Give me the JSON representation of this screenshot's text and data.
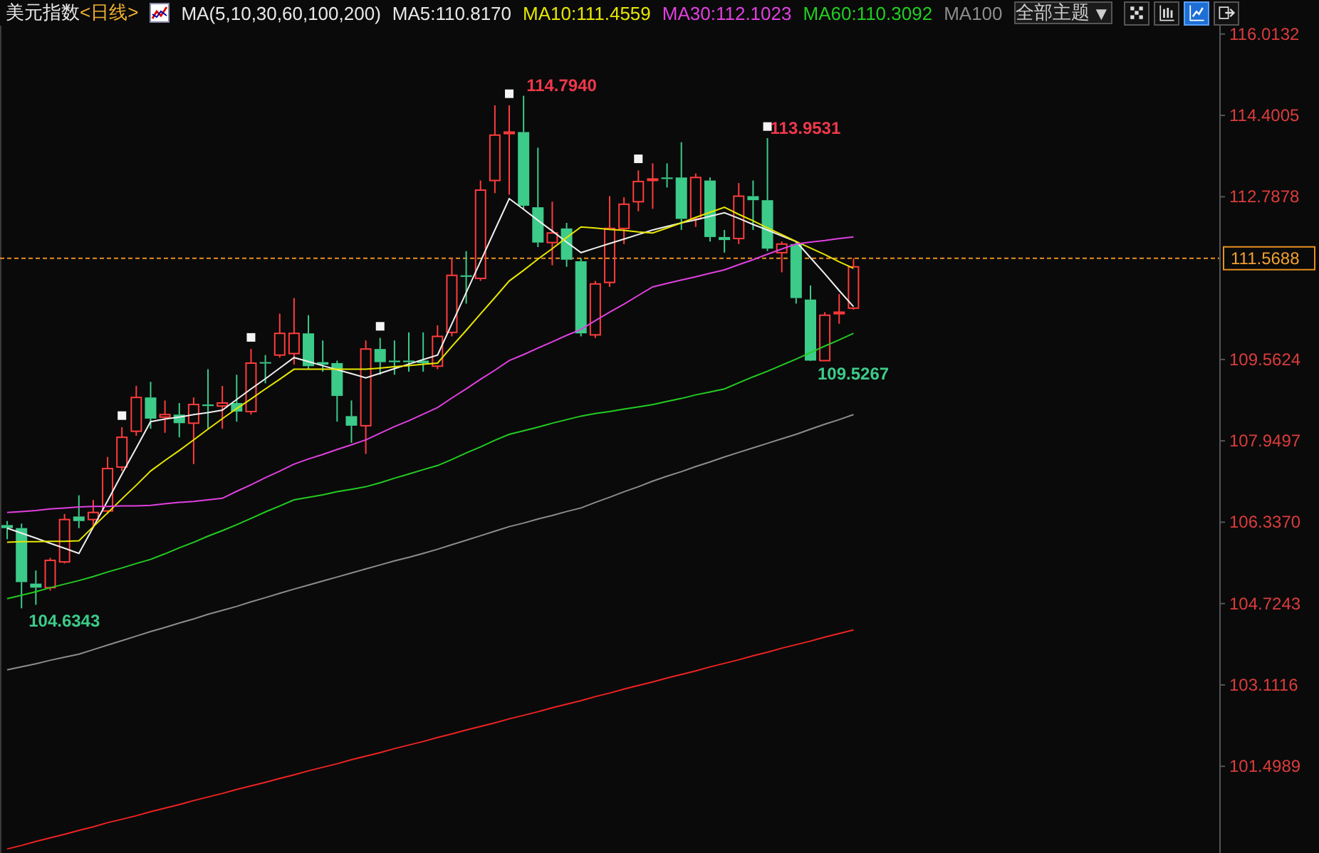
{
  "header": {
    "symbol": "美元指数",
    "period": "<日线>",
    "indicator": "MA(5,10,30,60,100,200)",
    "ma_values": [
      {
        "label": "MA5:110.8170",
        "color": "#e8e8e8"
      },
      {
        "label": "MA10:111.4559",
        "color": "#e6e600"
      },
      {
        "label": "MA30:112.1023",
        "color": "#e040e0"
      },
      {
        "label": "MA60:110.3092",
        "color": "#22cc22"
      },
      {
        "label": "MA100",
        "color": "#8c8c8c"
      }
    ],
    "theme_select": {
      "value": "全部主题",
      "caret": "▼"
    },
    "tools": [
      {
        "kind": "grid",
        "selected": false
      },
      {
        "kind": "bars",
        "selected": false
      },
      {
        "kind": "chart",
        "selected": true
      },
      {
        "kind": "exit",
        "selected": false
      }
    ]
  },
  "chart": {
    "chart_data": {
      "type": "candlestick",
      "ylim": [
        99.78,
        116.18
      ],
      "categories": [
        null,
        null,
        null,
        null,
        null,
        null,
        null,
        null,
        null,
        null,
        null,
        null,
        null,
        null,
        null,
        null,
        null,
        null,
        null,
        null,
        null,
        null,
        null,
        null,
        null,
        null,
        null,
        null,
        null,
        null,
        null,
        null,
        null,
        null,
        null,
        null,
        null,
        null,
        null,
        null,
        null,
        null,
        null,
        null,
        null,
        null,
        null,
        null,
        null,
        null,
        null,
        null,
        null,
        null,
        null,
        null,
        null,
        null,
        null,
        null,
        null,
        null,
        null,
        null,
        null,
        null,
        null,
        null,
        null,
        null,
        null,
        null,
        null,
        null,
        null,
        null,
        null,
        null,
        null,
        null,
        null,
        null,
        null,
        null,
        null
      ],
      "yticks": [
        {
          "value": 116.0132,
          "label": "116.0132"
        },
        {
          "value": 114.4005,
          "label": "114.4005"
        },
        {
          "value": 112.7878,
          "label": "112.7878"
        },
        {
          "value": 109.5624,
          "label": "109.5624"
        },
        {
          "value": 107.9497,
          "label": "107.9497"
        },
        {
          "value": 106.337,
          "label": "106.3370"
        },
        {
          "value": 104.7243,
          "label": "104.7243"
        },
        {
          "value": 103.1116,
          "label": "103.1116"
        },
        {
          "value": 101.4989,
          "label": "101.4989"
        }
      ],
      "ohlc": [
        [
          106.28,
          106.36,
          106.0,
          106.22
        ],
        [
          106.22,
          106.31,
          104.63,
          105.15
        ],
        [
          105.12,
          105.38,
          104.7,
          105.04
        ],
        [
          105.04,
          105.63,
          104.98,
          105.58
        ],
        [
          105.55,
          106.5,
          105.52,
          106.39
        ],
        [
          106.45,
          106.87,
          106.22,
          106.36
        ],
        [
          106.39,
          106.78,
          106.22,
          106.53
        ],
        [
          106.56,
          107.63,
          106.5,
          107.4
        ],
        [
          107.43,
          108.22,
          107.35,
          108.02
        ],
        [
          108.14,
          109.04,
          108.05,
          108.81
        ],
        [
          108.81,
          109.12,
          108.19,
          108.39
        ],
        [
          108.42,
          108.75,
          108.11,
          108.47
        ],
        [
          108.47,
          108.7,
          108.02,
          108.3
        ],
        [
          108.3,
          108.81,
          107.49,
          108.67
        ],
        [
          108.67,
          109.37,
          108.19,
          108.64
        ],
        [
          108.64,
          109.04,
          108.19,
          108.7
        ],
        [
          108.7,
          109.26,
          108.33,
          108.53
        ],
        [
          108.53,
          109.77,
          108.47,
          109.49
        ],
        [
          109.51,
          109.65,
          109.09,
          109.49
        ],
        [
          109.65,
          110.47,
          109.6,
          110.08
        ],
        [
          109.68,
          110.78,
          109.46,
          110.08
        ],
        [
          110.08,
          110.44,
          109.37,
          109.43
        ],
        [
          109.51,
          109.94,
          109.32,
          109.46
        ],
        [
          109.49,
          109.54,
          108.33,
          108.84
        ],
        [
          108.44,
          108.75,
          107.91,
          108.25
        ],
        [
          108.25,
          109.94,
          107.69,
          109.77
        ],
        [
          109.77,
          109.99,
          109.26,
          109.51
        ],
        [
          109.54,
          109.94,
          109.26,
          109.51
        ],
        [
          109.54,
          110.1,
          109.32,
          109.51
        ],
        [
          109.54,
          110.1,
          109.32,
          109.49
        ],
        [
          109.43,
          110.24,
          109.37,
          110.02
        ],
        [
          110.1,
          111.57,
          110.02,
          111.23
        ],
        [
          111.23,
          111.71,
          110.67,
          111.2
        ],
        [
          111.17,
          113.11,
          111.12,
          112.92
        ],
        [
          113.11,
          114.6,
          112.86,
          114.01
        ],
        [
          114.04,
          114.6,
          112.83,
          114.07
        ],
        [
          114.07,
          114.79,
          112.55,
          112.61
        ],
        [
          112.58,
          113.76,
          111.79,
          111.88
        ],
        [
          111.88,
          112.69,
          111.43,
          112.07
        ],
        [
          112.16,
          112.27,
          111.4,
          111.54
        ],
        [
          111.51,
          111.57,
          110.02,
          110.08
        ],
        [
          110.05,
          111.12,
          109.99,
          111.06
        ],
        [
          111.09,
          112.8,
          111.0,
          112.16
        ],
        [
          112.16,
          112.78,
          111.85,
          112.64
        ],
        [
          112.69,
          113.31,
          112.5,
          113.09
        ],
        [
          113.14,
          113.45,
          112.55,
          113.14
        ],
        [
          113.17,
          113.45,
          112.97,
          113.14
        ],
        [
          113.17,
          113.87,
          112.13,
          112.35
        ],
        [
          112.35,
          113.25,
          112.19,
          113.17
        ],
        [
          113.11,
          113.17,
          111.9,
          111.99
        ],
        [
          111.99,
          112.13,
          111.68,
          111.93
        ],
        [
          111.96,
          113.06,
          111.85,
          112.8
        ],
        [
          112.8,
          113.11,
          112.13,
          112.72
        ],
        [
          112.72,
          113.95,
          111.71,
          111.76
        ],
        [
          111.68,
          111.9,
          111.29,
          111.85
        ],
        [
          111.85,
          111.9,
          110.67,
          110.78
        ],
        [
          110.75,
          111.03,
          109.53,
          109.54
        ],
        [
          109.54,
          110.5,
          109.54,
          110.44
        ],
        [
          110.47,
          110.86,
          110.27,
          110.5
        ],
        [
          110.58,
          111.57,
          110.55,
          111.4
        ],
        null,
        null,
        null,
        null,
        null,
        null,
        null,
        null,
        null,
        null,
        null,
        null,
        null,
        null,
        null,
        null,
        null,
        null,
        null,
        null,
        null,
        null,
        null,
        null,
        null
      ],
      "series": [
        {
          "type": "line",
          "color": "#f0f0f0",
          "values": [
            106.22,
            106.12,
            106.02,
            105.92,
            105.82,
            105.72,
            106.24,
            106.76,
            107.29,
            107.81,
            108.33,
            108.38,
            108.42,
            108.47,
            108.51,
            108.56,
            108.77,
            108.98,
            109.18,
            109.39,
            109.6,
            109.52,
            109.44,
            109.36,
            109.28,
            109.2,
            109.29,
            109.38,
            109.47,
            109.56,
            109.65,
            110.27,
            110.89,
            111.51,
            112.13,
            112.75,
            112.54,
            112.32,
            112.11,
            111.89,
            111.68,
            111.77,
            111.86,
            111.95,
            112.04,
            112.13,
            112.2,
            112.27,
            112.33,
            112.4,
            112.47,
            112.36,
            112.24,
            112.13,
            112.01,
            111.9,
            111.58,
            111.26,
            110.93,
            110.61,
            null,
            null,
            null,
            null,
            null,
            null,
            null,
            null,
            null,
            null,
            null,
            null,
            null,
            null,
            null,
            null,
            null,
            null,
            null,
            null,
            null,
            null,
            null,
            null,
            null
          ]
        },
        {
          "type": "line",
          "color": "#e6e600",
          "values": [
            105.94,
            105.95,
            105.95,
            105.96,
            105.96,
            105.97,
            106.25,
            106.52,
            106.8,
            107.07,
            107.35,
            107.56,
            107.76,
            107.97,
            108.18,
            108.39,
            108.59,
            108.78,
            108.98,
            109.17,
            109.37,
            109.37,
            109.37,
            109.37,
            109.37,
            109.37,
            109.39,
            109.42,
            109.44,
            109.47,
            109.49,
            109.82,
            110.14,
            110.47,
            110.79,
            111.12,
            111.33,
            111.55,
            111.76,
            111.98,
            112.19,
            112.17,
            112.14,
            112.12,
            112.09,
            112.07,
            112.17,
            112.27,
            112.38,
            112.48,
            112.58,
            112.44,
            112.31,
            112.17,
            112.04,
            111.9,
            111.77,
            111.64,
            111.5,
            111.37,
            null,
            null,
            null,
            null,
            null,
            null,
            null,
            null,
            null,
            null,
            null,
            null,
            null,
            null,
            null,
            null,
            null,
            null,
            null,
            null,
            null,
            null,
            null,
            null,
            null
          ]
        },
        {
          "type": "line",
          "color": "#e040e0",
          "values": [
            106.53,
            106.55,
            106.57,
            106.6,
            106.62,
            106.64,
            106.65,
            106.65,
            106.66,
            106.66,
            106.67,
            106.7,
            106.73,
            106.75,
            106.78,
            106.81,
            106.95,
            107.08,
            107.22,
            107.35,
            107.49,
            107.59,
            107.68,
            107.78,
            107.87,
            107.97,
            108.1,
            108.23,
            108.35,
            108.48,
            108.61,
            108.8,
            108.98,
            109.17,
            109.35,
            109.54,
            109.66,
            109.79,
            109.91,
            110.04,
            110.16,
            110.33,
            110.5,
            110.66,
            110.83,
            111.0,
            111.07,
            111.14,
            111.2,
            111.27,
            111.34,
            111.44,
            111.54,
            111.65,
            111.75,
            111.85,
            111.89,
            111.92,
            111.96,
            111.99,
            null,
            null,
            null,
            null,
            null,
            null,
            null,
            null,
            null,
            null,
            null,
            null,
            null,
            null,
            null,
            null,
            null,
            null,
            null,
            null,
            null,
            null,
            null,
            null,
            null
          ]
        },
        {
          "type": "line",
          "color": "#22cc22",
          "values": [
            104.82,
            104.89,
            104.96,
            105.04,
            105.11,
            105.18,
            105.26,
            105.35,
            105.43,
            105.52,
            105.6,
            105.71,
            105.83,
            105.94,
            106.06,
            106.17,
            106.29,
            106.41,
            106.54,
            106.66,
            106.78,
            106.83,
            106.88,
            106.94,
            106.99,
            107.04,
            107.12,
            107.21,
            107.29,
            107.38,
            107.46,
            107.58,
            107.71,
            107.83,
            107.96,
            108.08,
            108.15,
            108.22,
            108.3,
            108.37,
            108.44,
            108.49,
            108.53,
            108.58,
            108.62,
            108.67,
            108.73,
            108.79,
            108.86,
            108.92,
            108.98,
            109.1,
            109.22,
            109.33,
            109.45,
            109.57,
            109.7,
            109.83,
            109.95,
            110.08,
            null,
            null,
            null,
            null,
            null,
            null,
            null,
            null,
            null,
            null,
            null,
            null,
            null,
            null,
            null,
            null,
            null,
            null,
            null,
            null,
            null,
            null,
            null,
            null,
            null
          ]
        },
        {
          "type": "line",
          "color": "#8c8c8c",
          "values": [
            103.41,
            103.47,
            103.53,
            103.6,
            103.66,
            103.72,
            103.81,
            103.9,
            103.99,
            104.08,
            104.17,
            104.25,
            104.34,
            104.42,
            104.51,
            104.59,
            104.67,
            104.76,
            104.84,
            104.93,
            105.01,
            105.09,
            105.17,
            105.25,
            105.33,
            105.41,
            105.49,
            105.57,
            105.64,
            105.72,
            105.8,
            105.89,
            105.98,
            106.07,
            106.16,
            106.25,
            106.32,
            106.4,
            106.47,
            106.55,
            106.62,
            106.73,
            106.83,
            106.94,
            107.04,
            107.15,
            107.25,
            107.34,
            107.44,
            107.53,
            107.63,
            107.72,
            107.81,
            107.9,
            107.99,
            108.08,
            108.18,
            108.28,
            108.37,
            108.47,
            null,
            null,
            null,
            null,
            null,
            null,
            null,
            null,
            null,
            null,
            null,
            null,
            null,
            null,
            null,
            null,
            null,
            null,
            null,
            null,
            null,
            null,
            null,
            null,
            null
          ]
        },
        {
          "type": "line",
          "color": "#ee2222",
          "values": [
            99.86,
            99.93,
            100.01,
            100.08,
            100.15,
            100.23,
            100.3,
            100.38,
            100.45,
            100.52,
            100.6,
            100.67,
            100.74,
            100.82,
            100.89,
            100.96,
            101.04,
            101.11,
            101.18,
            101.26,
            101.33,
            101.41,
            101.48,
            101.55,
            101.63,
            101.7,
            101.77,
            101.85,
            101.92,
            101.99,
            102.07,
            102.14,
            102.22,
            102.29,
            102.36,
            102.44,
            102.51,
            102.58,
            102.66,
            102.73,
            102.8,
            102.88,
            102.95,
            103.03,
            103.1,
            103.17,
            103.25,
            103.32,
            103.39,
            103.47,
            103.54,
            103.61,
            103.69,
            103.76,
            103.84,
            103.91,
            103.98,
            104.06,
            104.13,
            104.2,
            null,
            null,
            null,
            null,
            null,
            null,
            null,
            null,
            null,
            null,
            null,
            null,
            null,
            null,
            null,
            null,
            null,
            null,
            null,
            null,
            null,
            null,
            null,
            null,
            null
          ]
        },
        {
          "type": "scatter",
          "color": "#f4f4f4",
          "values": [
            null,
            null,
            null,
            null,
            null,
            null,
            null,
            null,
            108.45,
            null,
            null,
            null,
            null,
            null,
            null,
            null,
            null,
            110.0,
            null,
            null,
            null,
            null,
            null,
            null,
            null,
            null,
            110.22,
            null,
            null,
            null,
            null,
            null,
            null,
            null,
            null,
            114.83,
            null,
            null,
            null,
            null,
            null,
            null,
            null,
            null,
            113.54,
            null,
            null,
            null,
            null,
            null,
            null,
            null,
            null,
            114.18,
            null,
            null,
            null,
            null,
            null,
            null,
            null,
            null,
            null,
            null,
            null,
            null,
            null,
            null,
            null,
            null,
            null,
            null,
            null,
            null,
            null,
            null,
            null,
            null,
            null,
            null,
            null,
            null,
            null,
            null,
            null
          ]
        }
      ],
      "ref_lines": [
        {
          "axis": "y",
          "value": 111.5688,
          "label": "111.5688"
        }
      ],
      "annotations": [
        "104.6343",
        "114.7940",
        "113.9531",
        "109.5267"
      ]
    }
  }
}
